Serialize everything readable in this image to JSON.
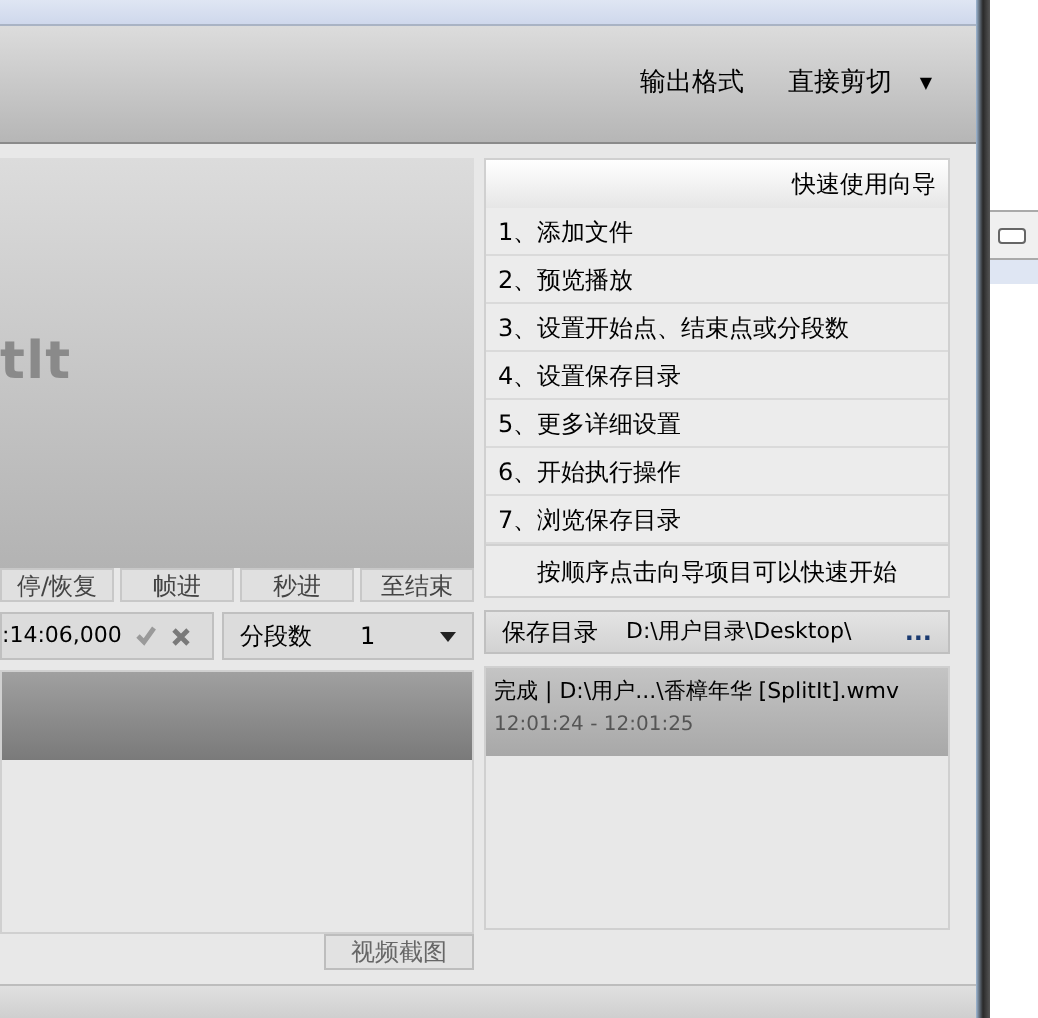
{
  "toolbar": {
    "items": [
      {
        "label": "输出格式",
        "kind": "plain"
      },
      {
        "label": "直接剪切",
        "kind": "dropdown"
      }
    ],
    "dropdown_arrow": "▼"
  },
  "preview": {
    "logo_text": "tlt"
  },
  "playback_buttons": [
    "停/恢复",
    "帧进",
    "秒进",
    "至结束"
  ],
  "time_field": {
    "value": ":14:06,000"
  },
  "segments": {
    "label": "分段数",
    "value": "1"
  },
  "guide": {
    "title": "快速使用向导",
    "items": [
      "1、添加文件",
      "2、预览播放",
      "3、设置开始点、结束点或分段数",
      "4、设置保存目录",
      "5、更多详细设置",
      "6、开始执行操作",
      "7、浏览保存目录"
    ],
    "footer": "按顺序点击向导项目可以快速开始"
  },
  "save_dir": {
    "label": "保存目录",
    "path": "D:\\用户目录\\Desktop\\",
    "browse": "..."
  },
  "left_list": {
    "items": [
      {
        "selected": true
      }
    ]
  },
  "results": [
    {
      "title": "完成 | D:\\用户...\\香樟年华 [SplitIt].wmv",
      "time": "12:01:24 - 12:01:25",
      "selected": true
    }
  ],
  "snapshot_button": "视频截图"
}
